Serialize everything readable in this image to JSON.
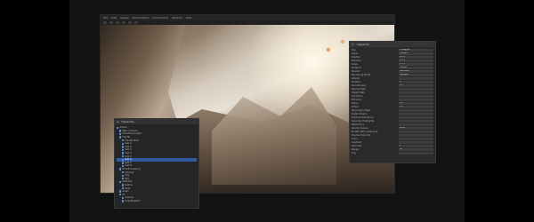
{
  "window": {
    "menu": [
      "File",
      "Edit",
      "Assets",
      "GameObject",
      "Component",
      "Window",
      "Help"
    ],
    "toolbar_icons": [
      "hand-icon",
      "move-icon",
      "rotate-icon",
      "scale-icon",
      "rect-icon",
      "transform-icon"
    ]
  },
  "scene": {
    "label": ""
  },
  "inspector": {
    "title": "Inspector",
    "rows": [
      {
        "label": "Tag",
        "value": "Untagged"
      },
      {
        "label": "Layer",
        "value": "Default"
      },
      {
        "label": "Position",
        "value": "0  0  0"
      },
      {
        "label": "Rotation",
        "value": "0  0  0"
      },
      {
        "label": "Scale",
        "value": "1  1  1"
      },
      {
        "label": "Material",
        "value": "Fractal"
      },
      {
        "label": "Shader",
        "value": "Standard"
      },
      {
        "label": "Rendering Mode",
        "value": "Opaque"
      },
      {
        "label": "Albedo",
        "value": ""
      },
      {
        "label": "Metallic",
        "value": "0"
      },
      {
        "label": "Smoothness",
        "value": "0.5"
      },
      {
        "label": "Normal Map",
        "value": ""
      },
      {
        "label": "Height Map",
        "value": ""
      },
      {
        "label": "Occlusion",
        "value": ""
      },
      {
        "label": "Emission",
        "value": ""
      },
      {
        "label": "Tiling",
        "value": "1  1"
      },
      {
        "label": "Offset",
        "value": "0  0"
      },
      {
        "label": "Secondary Maps",
        "value": ""
      },
      {
        "label": "Detail Albedo",
        "value": ""
      },
      {
        "label": "Forward Rendering",
        "value": ""
      },
      {
        "label": "Specular Highlights",
        "value": ""
      },
      {
        "label": "Reflections",
        "value": ""
      },
      {
        "label": "Render Queue",
        "value": "2000"
      },
      {
        "label": "Enable GPU Instancing",
        "value": ""
      },
      {
        "label": "Double Sided GI",
        "value": ""
      },
      {
        "label": "Color",
        "value": ""
      },
      {
        "label": "Gradient",
        "value": ""
      },
      {
        "label": "Intensity",
        "value": "1"
      },
      {
        "label": "Range",
        "value": "10"
      },
      {
        "label": "Fog",
        "value": ""
      }
    ]
  },
  "hierarchy": {
    "title": "Hierarchy",
    "items": [
      {
        "label": "Scene",
        "depth": 0
      },
      {
        "label": "Main Camera",
        "depth": 1
      },
      {
        "label": "Directional Light",
        "depth": 1
      },
      {
        "label": "Fractal",
        "depth": 1
      },
      {
        "label": "Fractal Root",
        "depth": 2
      },
      {
        "label": "Sub 1",
        "depth": 2
      },
      {
        "label": "Sub 2",
        "depth": 2
      },
      {
        "label": "Sub 3",
        "depth": 2
      },
      {
        "label": "Sub 4",
        "depth": 2
      },
      {
        "label": "Sub 5",
        "depth": 2
      },
      {
        "label": "Sub 6",
        "depth": 2
      },
      {
        "label": "Sub 7",
        "depth": 2
      },
      {
        "label": "Sub 8",
        "depth": 2
      },
      {
        "label": "Post Processing",
        "depth": 1
      },
      {
        "label": "Volume",
        "depth": 2
      },
      {
        "label": "Fog",
        "depth": 2
      },
      {
        "label": "Sky",
        "depth": 2
      },
      {
        "label": "Particles",
        "depth": 1
      },
      {
        "label": "Debris",
        "depth": 2
      },
      {
        "label": "Dust",
        "depth": 2
      },
      {
        "label": "Audio",
        "depth": 1
      },
      {
        "label": "UI",
        "depth": 1
      },
      {
        "label": "Canvas",
        "depth": 2
      },
      {
        "label": "EventSystem",
        "depth": 2
      }
    ],
    "selected_index": 10
  }
}
